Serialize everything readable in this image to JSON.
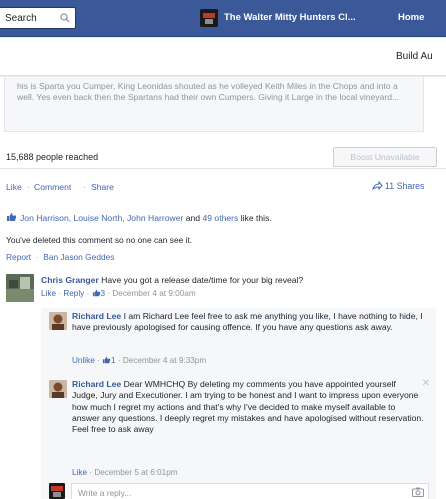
{
  "topbar": {
    "search_value": "Search",
    "page_name": "The Walter Mitty Hunters Cl...",
    "home_label": "Home"
  },
  "subbar": {
    "build_label": "Build Au"
  },
  "post": {
    "excerpt": "his is Sparta you Cumper, King Leonidas shouted as he volleyed Keith Miles in the Chops and into a well. Yes even back then the Spartans had their own Cumpers. Giving it Large in the local vineyard...",
    "reach": "15,688 people reached",
    "boost_label": "Boost Unavailable",
    "actions": {
      "like": "Like",
      "sep1": " · ",
      "comment": "Comment",
      "sep2": " · ",
      "share": "Share"
    },
    "shares": "11 Shares",
    "likes": {
      "names": "Jon Harrison, Louise North, John Harrower",
      "and": " and ",
      "others": "49 others",
      "suffix": " like this."
    },
    "deleted_notice": "You've deleted this comment so no one can see it.",
    "report_label": "Report",
    "ban_label": "Ban Jason Geddes"
  },
  "comments": [
    {
      "author": "Chris Granger",
      "text": " Have you got a release date/time for your big reveal?",
      "like": "Like",
      "reply": "Reply",
      "count": "3",
      "time": "December 4 at 9:00am"
    }
  ],
  "replies": [
    {
      "author": "Richard Lee",
      "text": " I am Richard Lee feel free to ask me anything you like, I have nothing to hide, I have previously apologised for causing offence. If you have any questions ask away.",
      "unlike": "Unlike",
      "count": "1",
      "time": "December 4 at 9:33pm"
    },
    {
      "author": "Richard Lee",
      "text": " Dear WMHCHQ By deleting my comments you have appointed yourself Judge, Jury and Executioner. I am trying to be honest and I want to impress upon everyone how much I regret my actions and that's why I've decided to make myself available to answer any questions. I deeply regret my mistakes and have apologised without reservation. Feel free to ask away",
      "like": "Like",
      "time": "December 5 at 6:01pm"
    }
  ],
  "reply_box": {
    "placeholder": "Write a reply..."
  },
  "icons": {
    "search": "search-icon",
    "thumb": "thumbs-up-icon",
    "share": "share-arrow-icon",
    "close": "close-icon",
    "camera": "camera-icon"
  },
  "colors": {
    "brand": "#3b5998",
    "link": "#4267b2",
    "muted": "#90949c"
  }
}
